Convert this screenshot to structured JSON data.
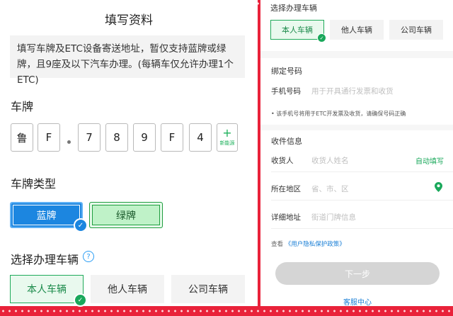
{
  "left": {
    "title": "填写资料",
    "notice": "填写车牌及ETC设备寄送地址，暂仅支持蓝牌或绿牌，且9座及以下汽车办理。(每辆车仅允许办理1个ETC)",
    "plate_section": "车牌",
    "plate_chars": [
      "鲁",
      "F",
      "7",
      "8",
      "9",
      "F",
      "4"
    ],
    "new_energy_plus": "+",
    "new_energy_label": "新能源",
    "plate_type_section": "车牌类型",
    "plate_types": [
      "蓝牌",
      "绿牌"
    ],
    "vehicle_section": "选择办理车辆",
    "help_glyph": "?",
    "vehicle_types": [
      "本人车辆",
      "他人车辆",
      "公司车辆"
    ]
  },
  "right": {
    "vehicle_section": "选择办理车辆",
    "vehicle_types": [
      "本人车辆",
      "他人车辆",
      "公司车辆"
    ],
    "bind_section": "绑定号码",
    "phone_label": "手机号码",
    "phone_placeholder": "用于开具通行发票和收货",
    "phone_note": "• 该手机号将用于ETC开发票及收货，请确保号码正确",
    "shipping_section": "收件信息",
    "recipient_label": "收货人",
    "recipient_placeholder": "收货人姓名",
    "autofill": "自动填写",
    "region_label": "所在地区",
    "region_placeholder": "省、市、区",
    "address_label": "详细地址",
    "address_placeholder": "街道门牌信息",
    "privacy_prefix": "查看",
    "privacy_link": "《用户隐私保护政策》",
    "next_button": "下一步",
    "service": "客服中心"
  },
  "colors": {
    "festive_red": "#e9223a",
    "blue_plate": "#1c86e0",
    "green_accent": "#1aa85b",
    "link_blue": "#1a7fd6"
  }
}
